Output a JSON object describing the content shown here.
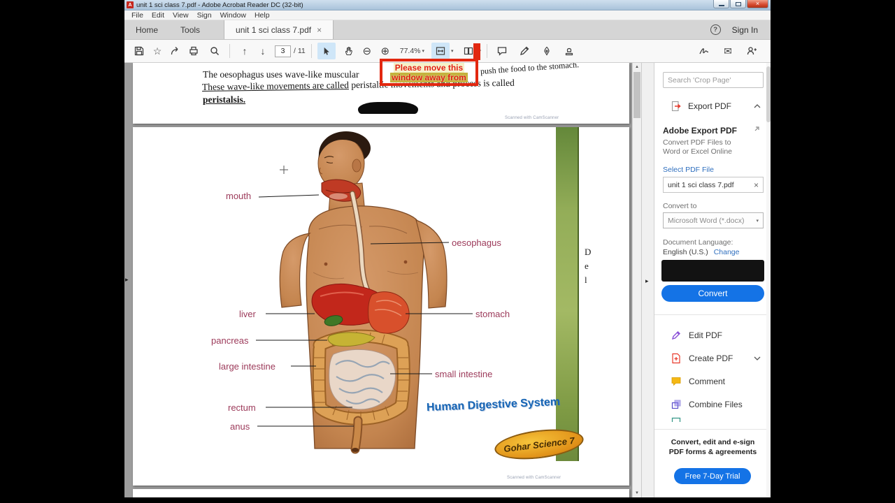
{
  "window": {
    "title": "unit 1 sci class 7.pdf - Adobe Acrobat Reader DC (32-bit)",
    "menu": [
      "File",
      "Edit",
      "View",
      "Sign",
      "Window",
      "Help"
    ]
  },
  "tabs": {
    "home": "Home",
    "tools": "Tools",
    "document": "unit 1 sci class 7.pdf",
    "sign_in": "Sign In",
    "help": "?"
  },
  "toolbar": {
    "page_current": "3",
    "page_total": "/ 11",
    "zoom_level": "77.4%"
  },
  "annotation": {
    "line1": "Please move this",
    "line2": "window away from"
  },
  "document": {
    "page1": {
      "line1_left": "The oesophagus uses wave-like muscular",
      "line1_right": "push the food to the stomach.",
      "line2_underlined": "These wave-like movements are called",
      "line2_rest": " peristaltic movements and process is called",
      "line3": "peristalsis.",
      "watermark": "Scanned with CamScanner"
    },
    "page2": {
      "labels": [
        "mouth",
        "oesophagus",
        "liver",
        "stomach",
        "pancreas",
        "large intestine",
        "small intestine",
        "rectum",
        "anus"
      ],
      "title": "Human Digestive System",
      "badge": "Gohar Science 7",
      "watermark": "Scanned with CamScanner",
      "edge_letters": [
        "D",
        "e",
        "l"
      ]
    }
  },
  "panel": {
    "search_placeholder": "Search 'Crop Page'",
    "export_header": "Export PDF",
    "adobe_export_title": "Adobe Export PDF",
    "description": "Convert PDF Files to Word or Excel Online",
    "select_file_link": "Select PDF File",
    "file_name": "unit 1 sci class 7.pdf",
    "convert_to_label": "Convert to",
    "format_value": "Microsoft Word (*.docx)",
    "language_label": "Document Language:",
    "language_value": "English (U.S.)",
    "change_link": "Change",
    "convert_button": "Convert",
    "tools": [
      "Edit PDF",
      "Create PDF",
      "Comment",
      "Combine Files"
    ],
    "promo_text": "Convert, edit and e-sign PDF forms & agreements",
    "trial_button": "Free 7-Day Trial"
  },
  "icons": {
    "star": "☆",
    "page_up": "↑",
    "page_down": "↓",
    "zoom_out": "⊖",
    "zoom_in": "⊕",
    "caret_down": "▾",
    "envelope": "✉",
    "close_x": "×",
    "panel_collapse": "▸",
    "scroll_up": "▲",
    "scroll_down": "▼"
  },
  "colors": {
    "accent_blue": "#1473e6",
    "close_red": "#d6492f",
    "diagram_label": "#9c3a5a",
    "diagram_title_blue": "#1765b5"
  }
}
